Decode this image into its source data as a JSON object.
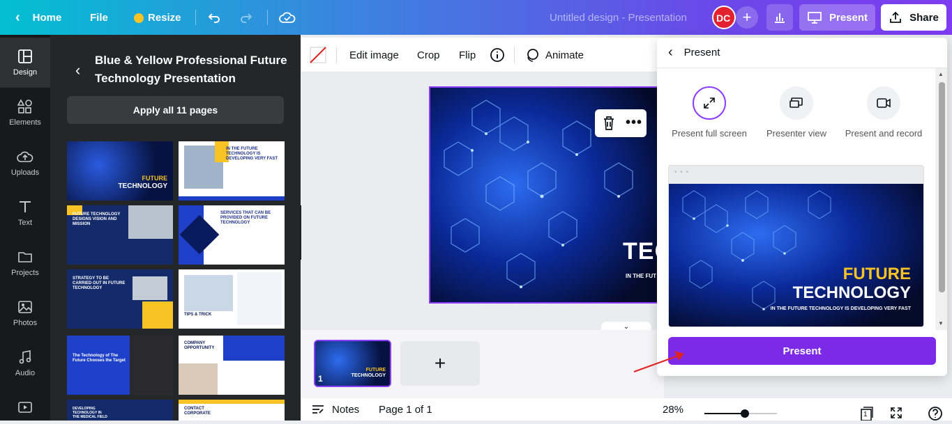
{
  "topbar": {
    "home": "Home",
    "file": "File",
    "resize": "Resize",
    "doc_title": "Untitled design - Presentation",
    "present": "Present",
    "share": "Share"
  },
  "sidebar": {
    "items": [
      {
        "label": "Design"
      },
      {
        "label": "Elements"
      },
      {
        "label": "Uploads"
      },
      {
        "label": "Text"
      },
      {
        "label": "Projects"
      },
      {
        "label": "Photos"
      },
      {
        "label": "Audio"
      }
    ]
  },
  "panel": {
    "title": "Blue & Yellow Professional Future Technology Presentation",
    "apply_label": "Apply all 11 pages",
    "thumbs": [
      {
        "title": "FUTURE",
        "sub": "TECHNOLOGY"
      },
      {
        "title": "IN THE FUTURE TECHNOLOGY IS DEVELOPING VERY FAST"
      },
      {
        "title": "FUTURE TECHNOLOGY DESIGNS VISION AND MISSION"
      },
      {
        "title": "SERVICES THAT CAN BE PROVIDED ON FUTURE TECHNOLOGY"
      },
      {
        "title": "STRATEGY TO BE CARRIED OUT IN FUTURE TECHNOLOGY"
      },
      {
        "title": "TIPS & TRICK"
      },
      {
        "title": "The Technology of The Future Chooses the Target"
      },
      {
        "title": "COMPANY OPPORTUNITY"
      },
      {
        "title": "DEVELOPING TECHNOLOGY IN THE MEDICAL FIELD"
      },
      {
        "title": "CONTACT CORPORATE"
      }
    ]
  },
  "context_toolbar": {
    "edit_image": "Edit image",
    "crop": "Crop",
    "flip": "Flip",
    "animate": "Animate"
  },
  "slide": {
    "title_part": "TEC",
    "sub_part": "IN THE FUT"
  },
  "page_strip": {
    "thumb_number": "1",
    "thumb_title": "FUTURE",
    "thumb_sub": "TECHNOLOGY",
    "add_label": "+"
  },
  "bottombar": {
    "notes": "Notes",
    "page": "Page 1 of 1",
    "zoom": "28%",
    "zoom_level": 0.28,
    "page_count": "1"
  },
  "present_menu": {
    "back_label": "Present",
    "options": [
      {
        "label": "Present full screen",
        "icon": "expand-icon"
      },
      {
        "label": "Presenter view",
        "icon": "presenter-view-icon"
      },
      {
        "label": "Present and record",
        "icon": "camera-icon"
      }
    ],
    "preview_title": "FUTURE",
    "preview_sub": "TECHNOLOGY",
    "preview_tagline": "IN THE FUTURE TECHNOLOGY IS DEVELOPING VERY FAST",
    "present_button": "Present"
  },
  "colors": {
    "accent": "#7d2ae8",
    "selection": "#8b3dff",
    "future_yellow": "#f7c325",
    "dark_panel": "#252627"
  }
}
